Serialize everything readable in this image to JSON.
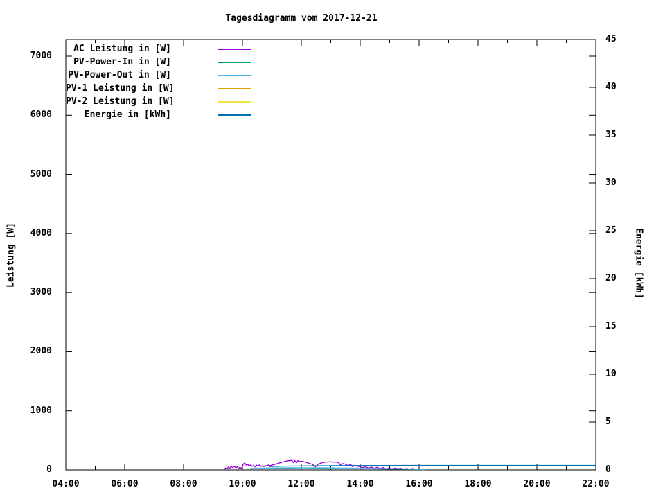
{
  "page": {
    "background": "#ffffff",
    "plot_border_color": "#000000",
    "text_color": "#000000"
  },
  "chart_data": {
    "type": "line",
    "title": "Tagesdiagramm vom 2017-12-21",
    "ylabel_left": "Leistung [W]",
    "ylabel_right": "Energie [kWh]",
    "grid": false,
    "legend_position": "top-left-inside",
    "x_axis": {
      "unit": "time",
      "start_hour": 4,
      "end_hour": 22,
      "major_ticks": [
        4,
        6,
        8,
        10,
        12,
        14,
        16,
        18,
        20,
        22
      ],
      "major_tick_labels": [
        "04:00",
        "06:00",
        "08:00",
        "10:00",
        "12:00",
        "14:00",
        "16:00",
        "18:00",
        "20:00",
        "22:00"
      ],
      "minor_ticks": [
        5,
        7,
        9,
        11,
        13,
        15,
        17,
        19,
        21
      ]
    },
    "y1_axis": {
      "label": "Leistung [W]",
      "min": 0,
      "max_labeled": 7000,
      "ticks": [
        0,
        1000,
        2000,
        3000,
        4000,
        5000,
        6000,
        7000
      ],
      "tick_labels": [
        "0",
        "1000",
        "2000",
        "3000",
        "4000",
        "5000",
        "6000",
        "7000"
      ],
      "mirrored_on_right": true
    },
    "y2_axis": {
      "label": "Energie [kWh]",
      "min": 0,
      "max": 45,
      "ticks": [
        0,
        5,
        10,
        15,
        20,
        25,
        30,
        35,
        40,
        45
      ],
      "tick_labels": [
        "0",
        "5",
        "10",
        "15",
        "20",
        "25",
        "30",
        "35",
        "40",
        "45"
      ]
    },
    "series": [
      {
        "name": "AC Leistung in [W]",
        "color": "#9400d3",
        "axis": "y1",
        "points": [
          [
            9.37,
            5
          ],
          [
            9.42,
            30
          ],
          [
            9.47,
            18
          ],
          [
            9.52,
            48
          ],
          [
            9.57,
            28
          ],
          [
            9.62,
            58
          ],
          [
            9.67,
            38
          ],
          [
            9.72,
            62
          ],
          [
            9.77,
            35
          ],
          [
            9.82,
            52
          ],
          [
            9.87,
            26
          ],
          [
            9.92,
            44
          ],
          [
            9.97,
            22
          ],
          [
            10.03,
            100
          ],
          [
            10.08,
            118
          ],
          [
            10.13,
            80
          ],
          [
            10.18,
            95
          ],
          [
            10.23,
            65
          ],
          [
            10.28,
            85
          ],
          [
            10.33,
            60
          ],
          [
            10.38,
            75
          ],
          [
            10.43,
            52
          ],
          [
            10.48,
            80
          ],
          [
            10.53,
            62
          ],
          [
            10.58,
            84
          ],
          [
            10.63,
            58
          ],
          [
            10.68,
            70
          ],
          [
            10.73,
            55
          ],
          [
            10.78,
            75
          ],
          [
            10.83,
            62
          ],
          [
            10.88,
            84
          ],
          [
            10.93,
            70
          ],
          [
            10.98,
            80
          ],
          [
            11.08,
            92
          ],
          [
            11.18,
            105
          ],
          [
            11.28,
            122
          ],
          [
            11.38,
            135
          ],
          [
            11.48,
            148
          ],
          [
            11.58,
            156
          ],
          [
            11.68,
            162
          ],
          [
            11.73,
            126
          ],
          [
            11.78,
            158
          ],
          [
            11.83,
            118
          ],
          [
            11.88,
            155
          ],
          [
            11.93,
            140
          ],
          [
            11.98,
            148
          ],
          [
            12.08,
            140
          ],
          [
            12.18,
            126
          ],
          [
            12.28,
            110
          ],
          [
            12.38,
            92
          ],
          [
            12.48,
            52
          ],
          [
            12.58,
            100
          ],
          [
            12.68,
            118
          ],
          [
            12.78,
            130
          ],
          [
            12.88,
            135
          ],
          [
            12.98,
            140
          ],
          [
            13.08,
            130
          ],
          [
            13.18,
            135
          ],
          [
            13.28,
            118
          ],
          [
            13.33,
            82
          ],
          [
            13.38,
            108
          ],
          [
            13.48,
            100
          ],
          [
            13.58,
            74
          ],
          [
            13.68,
            92
          ],
          [
            13.73,
            56
          ],
          [
            13.78,
            78
          ],
          [
            13.88,
            65
          ],
          [
            13.98,
            56
          ],
          [
            14.08,
            40
          ],
          [
            14.18,
            52
          ],
          [
            14.28,
            30
          ],
          [
            14.38,
            48
          ],
          [
            14.48,
            26
          ],
          [
            14.58,
            44
          ],
          [
            14.68,
            22
          ],
          [
            14.78,
            40
          ],
          [
            14.88,
            18
          ],
          [
            14.98,
            35
          ],
          [
            15.08,
            16
          ],
          [
            15.18,
            30
          ],
          [
            15.28,
            20
          ],
          [
            15.38,
            26
          ],
          [
            15.48,
            14
          ],
          [
            15.58,
            24
          ],
          [
            15.68,
            10
          ],
          [
            15.78,
            22
          ],
          [
            15.88,
            8
          ],
          [
            15.98,
            18
          ],
          [
            16.08,
            6
          ],
          [
            16.17,
            4
          ]
        ]
      },
      {
        "name": "PV-Power-In in [W]",
        "color": "#009e73",
        "axis": "y1",
        "points": [
          [
            10.15,
            18
          ],
          [
            10.4,
            22
          ],
          [
            10.8,
            25
          ],
          [
            11.2,
            28
          ],
          [
            11.6,
            32
          ],
          [
            12.0,
            35
          ],
          [
            12.4,
            30
          ],
          [
            12.8,
            32
          ],
          [
            13.2,
            28
          ],
          [
            13.6,
            25
          ],
          [
            14.0,
            22
          ],
          [
            14.5,
            18
          ],
          [
            15.0,
            15
          ],
          [
            15.5,
            12
          ],
          [
            16.0,
            8
          ],
          [
            16.2,
            5
          ]
        ]
      },
      {
        "name": "PV-Power-Out in [W]",
        "color": "#56b4e9",
        "axis": "y1",
        "points": [
          [
            10.3,
            28
          ],
          [
            10.8,
            32
          ],
          [
            11.3,
            35
          ],
          [
            11.8,
            38
          ],
          [
            12.3,
            35
          ],
          [
            12.8,
            36
          ],
          [
            13.3,
            32
          ],
          [
            13.8,
            30
          ],
          [
            14.3,
            26
          ],
          [
            14.8,
            22
          ],
          [
            15.3,
            18
          ],
          [
            15.8,
            14
          ],
          [
            16.2,
            10
          ]
        ]
      },
      {
        "name": "PV-1 Leistung in [W]",
        "color": "#e69f00",
        "axis": "y1",
        "points": []
      },
      {
        "name": "PV-2 Leistung in [W]",
        "color": "#f0e442",
        "axis": "y1",
        "points": []
      },
      {
        "name": "Energie in [kWh]",
        "color": "#0072b2",
        "axis": "y2",
        "points": [
          [
            10.9,
            0.35
          ],
          [
            11.5,
            0.4
          ],
          [
            12.5,
            0.43
          ],
          [
            13.5,
            0.45
          ],
          [
            14.5,
            0.46
          ],
          [
            16.0,
            0.47
          ],
          [
            18.0,
            0.47
          ],
          [
            20.0,
            0.47
          ],
          [
            22.0,
            0.47
          ]
        ]
      }
    ]
  }
}
